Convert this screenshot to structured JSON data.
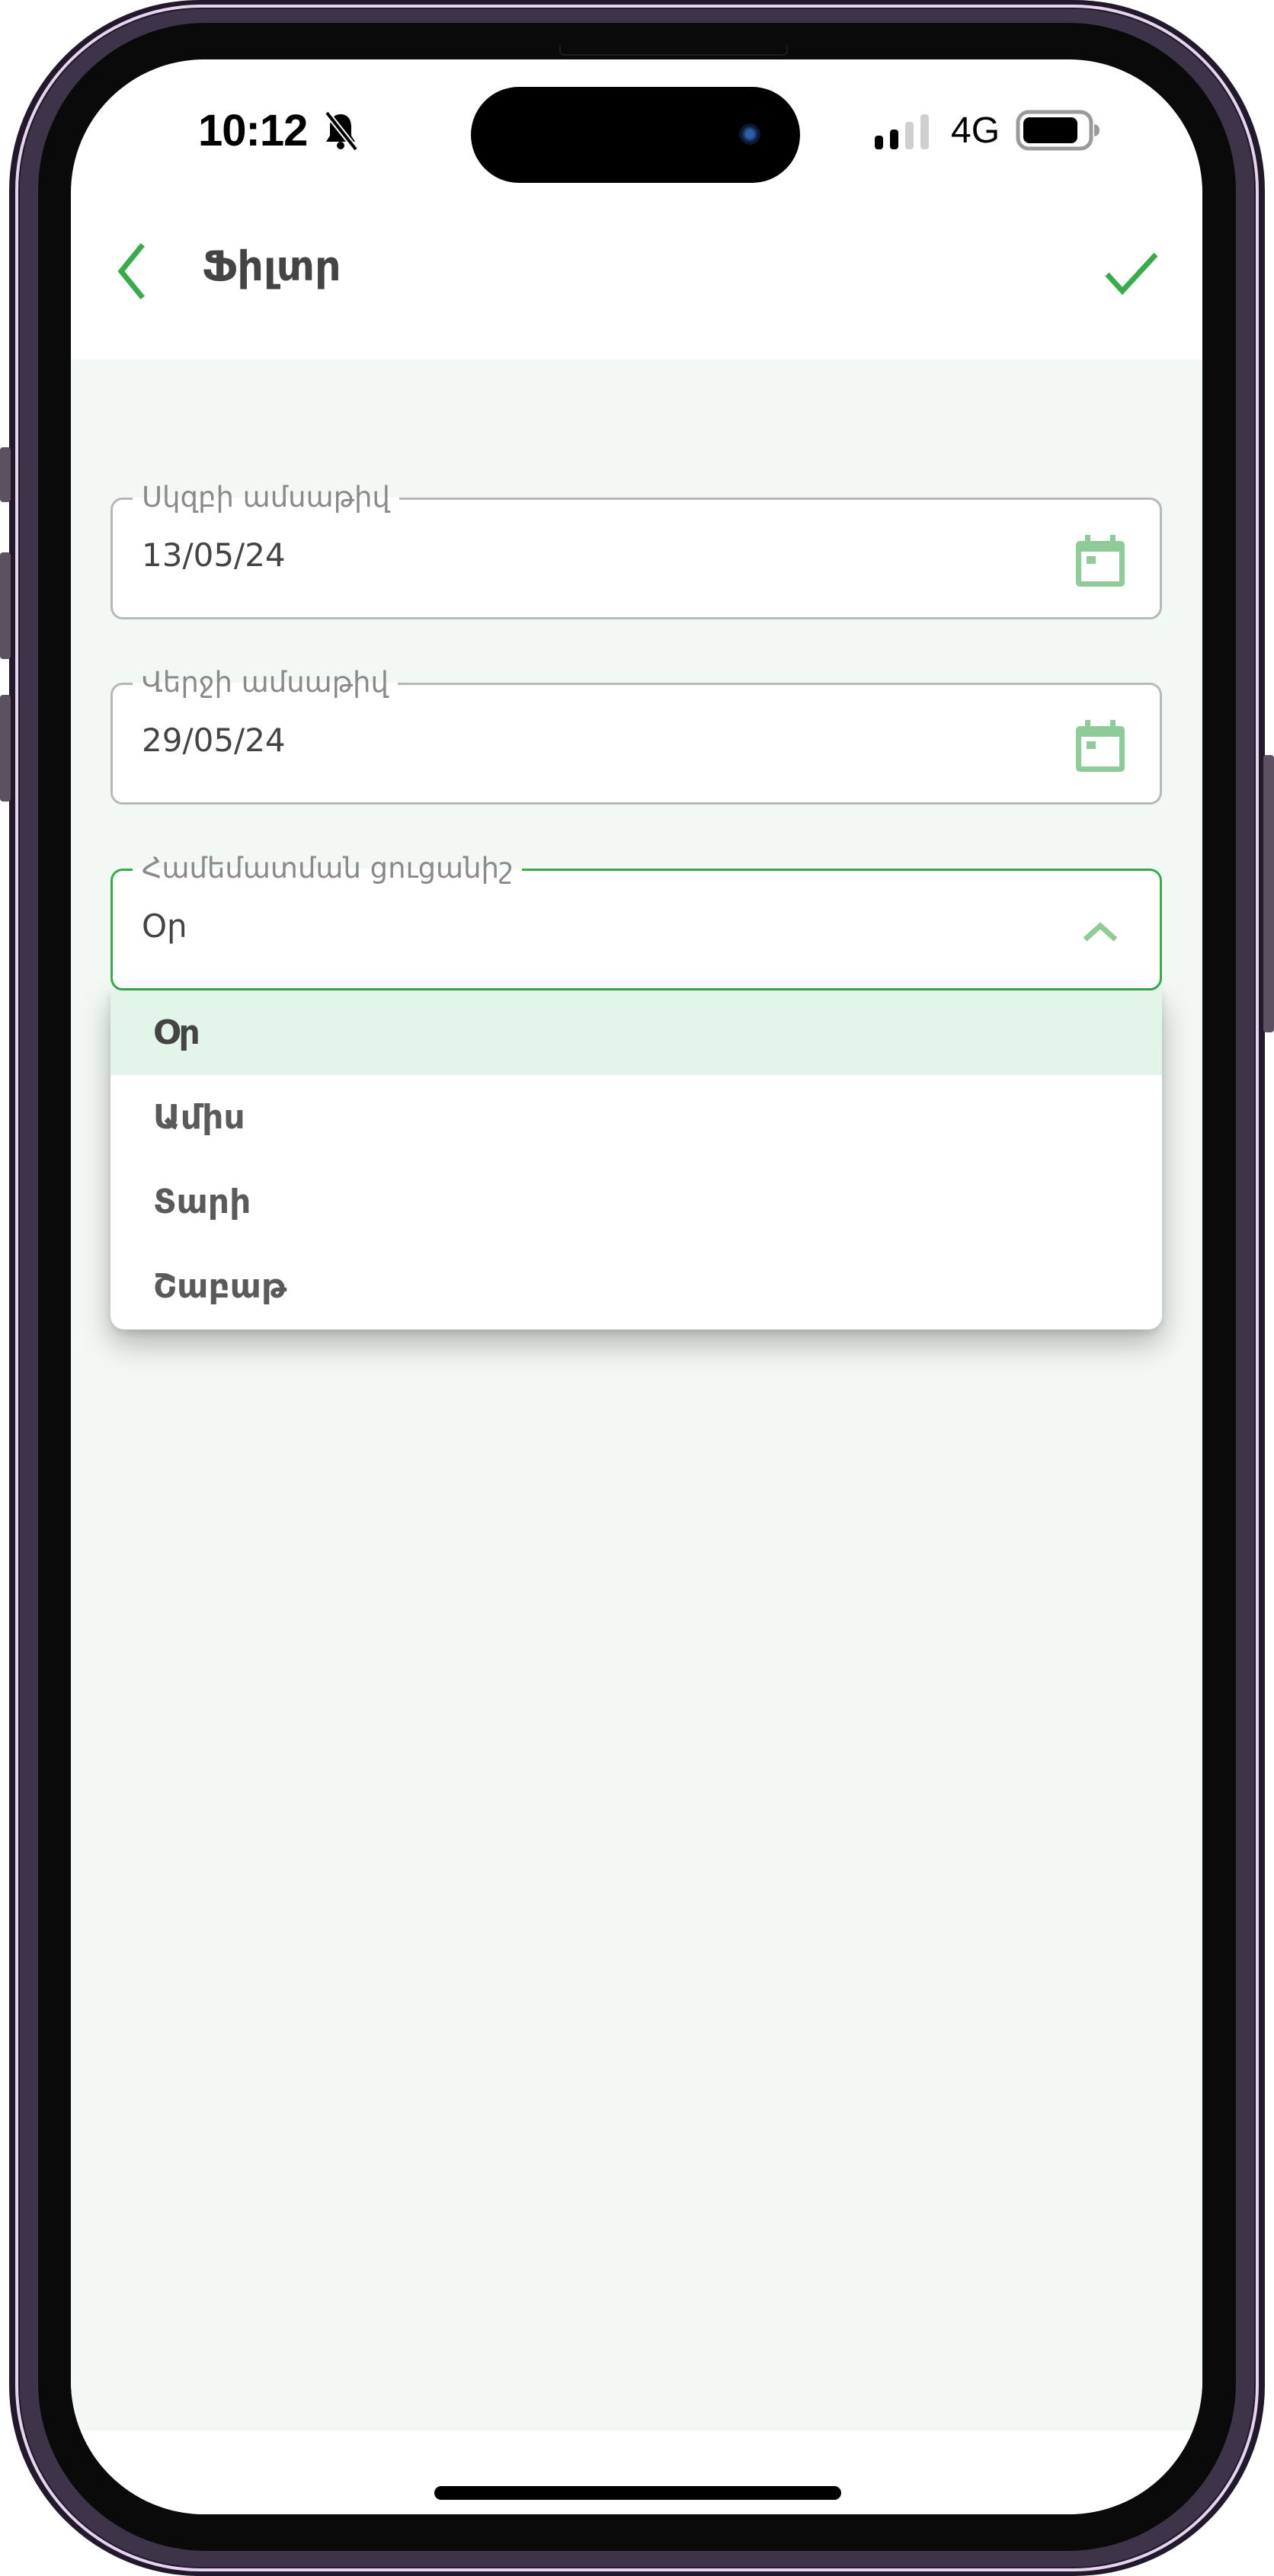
{
  "status_bar": {
    "time": "10:12",
    "network": "4G",
    "mute_icon": "bell-slash-icon",
    "signal_bars_active": 2,
    "signal_bars_total": 4,
    "battery_level": 0.85
  },
  "header": {
    "title": "Ֆիլտր",
    "back_icon": "chevron-left-icon",
    "confirm_icon": "checkmark-icon"
  },
  "colors": {
    "accent": "#3aaa4b",
    "icon_green": "#8fcb99",
    "background": "#f2f8f4",
    "selected_item": "#e3f4e8",
    "text": "#444444",
    "label": "#8a8a8a"
  },
  "form": {
    "start_date": {
      "label": "Սկզբի ամսաթիվ",
      "value": "13/05/24",
      "icon": "calendar-icon"
    },
    "end_date": {
      "label": "Վերջի ամսաթիվ",
      "value": "29/05/24",
      "icon": "calendar-icon"
    },
    "comparison": {
      "label": "Համեմատման ցուցանիշ",
      "value": "Օր",
      "icon": "chevron-up-icon",
      "expanded": true,
      "options": [
        "Օր",
        "Ամիս",
        "Տարի",
        "Շաբաթ"
      ],
      "selected_index": 0
    }
  }
}
